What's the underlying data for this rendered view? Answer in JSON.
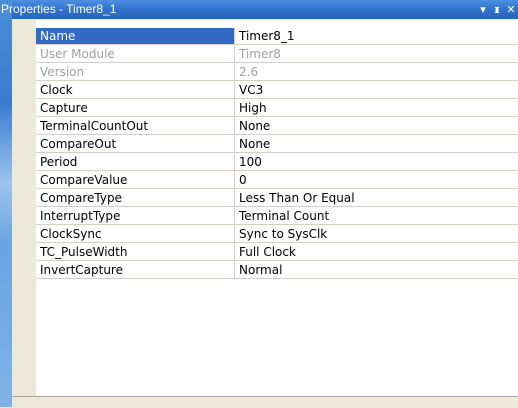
{
  "window": {
    "title": "Properties - Timer8_1",
    "dropdown_icon": "triangle-down",
    "pin_icon": "pin",
    "close_icon": "close-x"
  },
  "properties": [
    {
      "name": "Name",
      "value": "Timer8_1"
    },
    {
      "name": "User Module",
      "value": "Timer8"
    },
    {
      "name": "Version",
      "value": "2.6"
    },
    {
      "name": "Clock",
      "value": "VC3"
    },
    {
      "name": "Capture",
      "value": "High"
    },
    {
      "name": "TerminalCountOut",
      "value": "None"
    },
    {
      "name": "CompareOut",
      "value": "None"
    },
    {
      "name": "Period",
      "value": "100"
    },
    {
      "name": "CompareValue",
      "value": "0"
    },
    {
      "name": "CompareType",
      "value": "Less Than Or Equal"
    },
    {
      "name": "InterruptType",
      "value": "Terminal Count"
    },
    {
      "name": "ClockSync",
      "value": "Sync to SysClk"
    },
    {
      "name": "TC_PulseWidth",
      "value": "Full Clock"
    },
    {
      "name": "InvertCapture",
      "value": "Normal"
    }
  ],
  "colors": {
    "title_bar": "#2f6fc9",
    "selection": "#316ac5",
    "disabled_text": "#a0a0a0"
  }
}
